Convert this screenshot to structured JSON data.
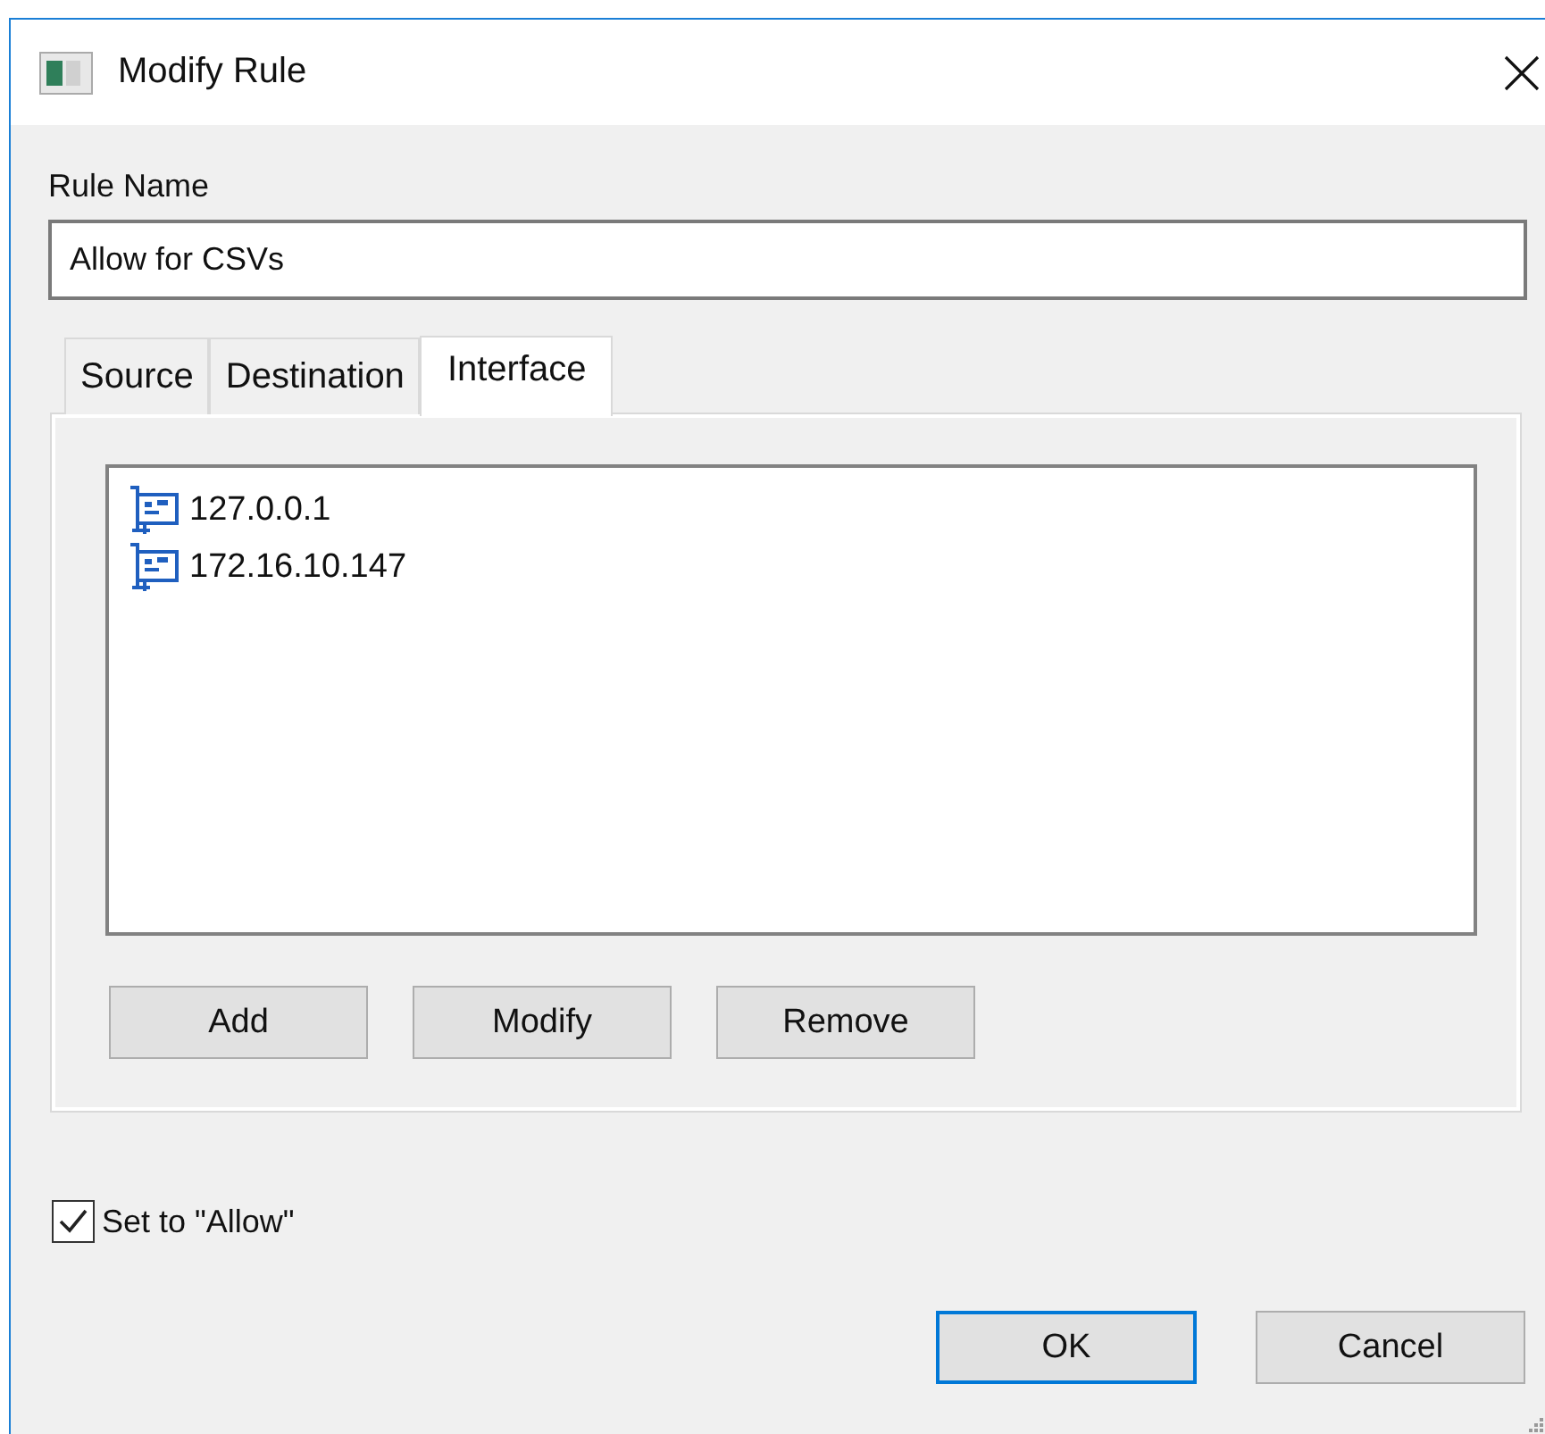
{
  "window": {
    "title": "Modify Rule"
  },
  "rule_name": {
    "label": "Rule Name",
    "value": "Allow for CSVs"
  },
  "tabs": [
    {
      "label": "Source",
      "selected": false
    },
    {
      "label": "Destination",
      "selected": false
    },
    {
      "label": "Interface",
      "selected": true
    }
  ],
  "interfaces": [
    "127.0.0.1",
    "172.16.10.147"
  ],
  "list_buttons": [
    "Add",
    "Modify",
    "Remove"
  ],
  "allow_checkbox": {
    "label": "Set to \"Allow\"",
    "checked": true
  },
  "buttons": [
    {
      "label": "OK",
      "default": true
    },
    {
      "label": "Cancel",
      "default": false
    }
  ]
}
